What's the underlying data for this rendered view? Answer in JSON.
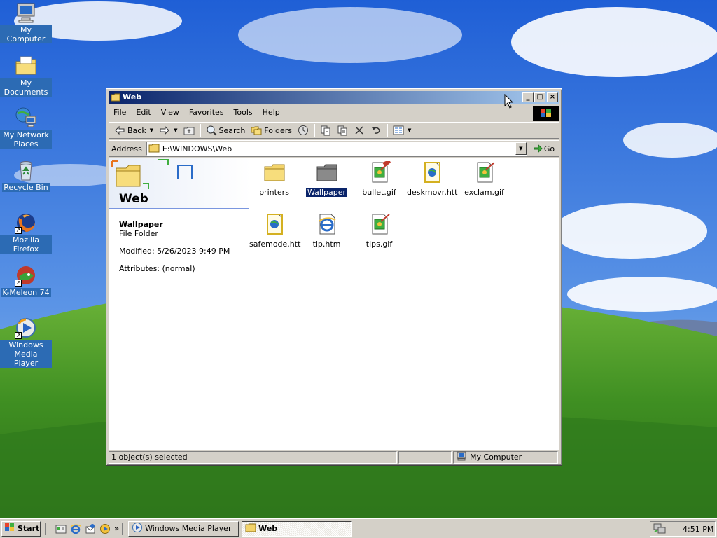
{
  "desktop": {
    "icons": [
      {
        "label": "My Computer",
        "icon": "my-computer-icon"
      },
      {
        "label": "My Documents",
        "icon": "my-documents-icon"
      },
      {
        "label": "My Network Places",
        "icon": "network-places-icon"
      },
      {
        "label": "Recycle Bin",
        "icon": "recycle-bin-icon"
      },
      {
        "label": "Mozilla Firefox",
        "icon": "firefox-icon"
      },
      {
        "label": "K-Meleon 74",
        "icon": "k-meleon-icon"
      },
      {
        "label": "Windows Media Player",
        "icon": "media-player-icon"
      }
    ]
  },
  "window": {
    "title": "Web",
    "menu": [
      "File",
      "Edit",
      "View",
      "Favorites",
      "Tools",
      "Help"
    ],
    "toolbar": {
      "back": "Back",
      "search": "Search",
      "folders": "Folders"
    },
    "address": {
      "label": "Address",
      "value": "E:\\WINDOWS\\Web",
      "go": "Go"
    },
    "pane": {
      "title": "Web",
      "selected_name": "Wallpaper",
      "selected_type": "File Folder",
      "modified": "Modified: 5/26/2023 9:49 PM",
      "attributes": "Attributes: (normal)"
    },
    "files": [
      {
        "name": "printers",
        "icon": "folder-icon"
      },
      {
        "name": "Wallpaper",
        "icon": "folder-icon",
        "selected": true
      },
      {
        "name": "bullet.gif",
        "icon": "gif-image-icon"
      },
      {
        "name": "deskmovr.htt",
        "icon": "htt-file-icon"
      },
      {
        "name": "exclam.gif",
        "icon": "gif-image-icon"
      },
      {
        "name": "safemode.htt",
        "icon": "htt-file-icon"
      },
      {
        "name": "tip.htm",
        "icon": "ie-html-icon"
      },
      {
        "name": "tips.gif",
        "icon": "gif-image-icon"
      }
    ],
    "status": {
      "selection": "1 object(s) selected",
      "zone": "My Computer"
    }
  },
  "taskbar": {
    "start": "Start",
    "quick_launch_more": "»",
    "tasks": [
      {
        "label": "Windows Media Player",
        "active": false
      },
      {
        "label": "Web",
        "active": true
      }
    ],
    "clock": "4:51 PM"
  },
  "colors": {
    "titlebar_start": "#0a246a",
    "titlebar_end": "#a6caf0",
    "selection": "#0a246a",
    "face": "#d4d0c8"
  }
}
